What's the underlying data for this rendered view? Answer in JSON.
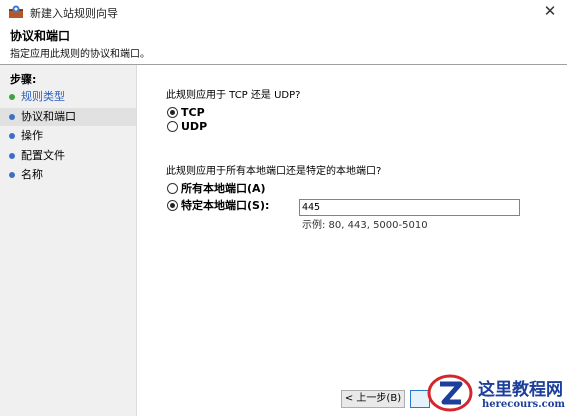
{
  "window": {
    "title": "新建入站规则向导",
    "close_glyph": "✕"
  },
  "header": {
    "title": "协议和端口",
    "subtitle": "指定应用此规则的协议和端口。"
  },
  "steps": {
    "title": "步骤:",
    "items": [
      {
        "label": "规则类型",
        "dot_color": "#3ea33e"
      },
      {
        "label": "协议和端口",
        "dot_color": "#3d6fc7"
      },
      {
        "label": "操作",
        "dot_color": "#3d6fc7"
      },
      {
        "label": "配置文件",
        "dot_color": "#3d6fc7"
      },
      {
        "label": "名称",
        "dot_color": "#3d6fc7"
      }
    ],
    "active_index": 1
  },
  "protocol": {
    "question": "此规则应用于 TCP 还是 UDP?",
    "options": [
      {
        "label": "TCP",
        "selected": true
      },
      {
        "label": "UDP",
        "selected": false
      }
    ]
  },
  "ports": {
    "question": "此规则应用于所有本地端口还是特定的本地端口?",
    "options": [
      {
        "label": "所有本地端口(A)",
        "selected": false
      },
      {
        "label": "特定本地端口(S):",
        "selected": true
      }
    ],
    "value": "445",
    "example": "示例: 80, 443, 5000-5010"
  },
  "buttons": {
    "back": "< 上一步(B)"
  },
  "watermark": {
    "cn": "这里教程网",
    "en": "herecours.com"
  },
  "colors": {
    "accent": "#2b6cb3",
    "link": "#2b5fbf",
    "watermark": "#1b3f9a"
  }
}
